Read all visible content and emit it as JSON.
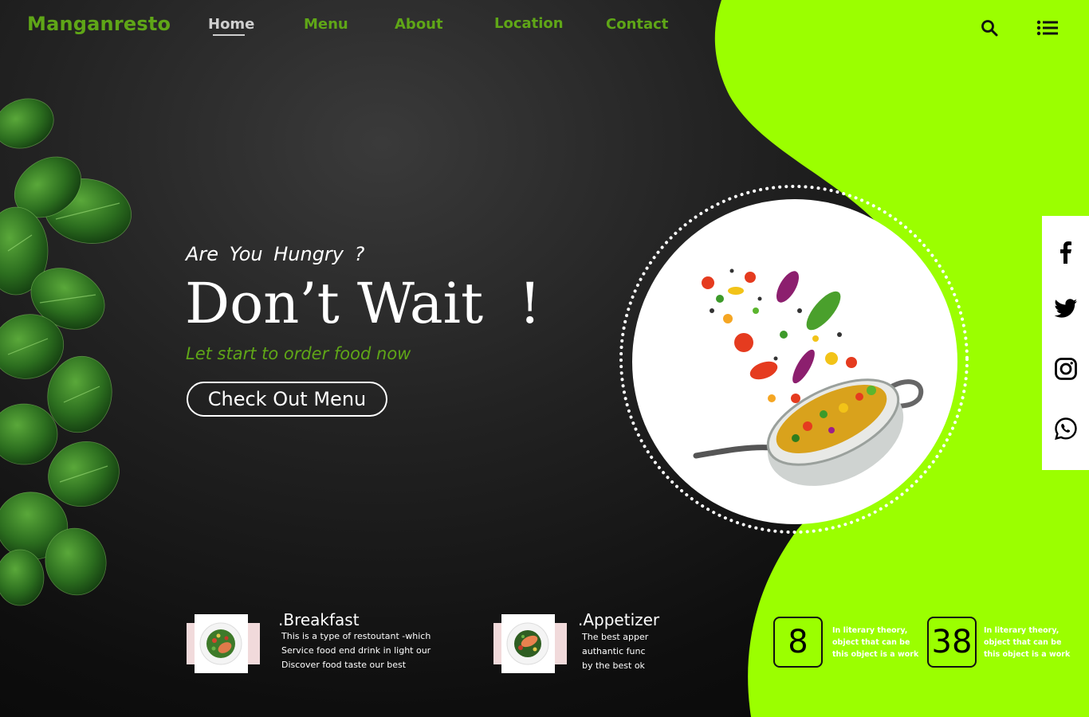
{
  "brand": {
    "name": "Manganresto",
    "accent": "#5fa617",
    "lime": "#9bff00"
  },
  "nav": {
    "items": [
      {
        "label": "Home",
        "active": true
      },
      {
        "label": "Menu"
      },
      {
        "label": "About"
      },
      {
        "label": "Location"
      },
      {
        "label": "Contact"
      }
    ],
    "search_icon": "search-icon",
    "menu_icon": "list-menu-icon"
  },
  "hero": {
    "kicker": "Are You Hungry ?",
    "title": "Don’t Wait  !",
    "subtitle": "Let start to order food now",
    "cta_label": "Check Out Menu"
  },
  "social": [
    "facebook-icon",
    "twitter-icon",
    "instagram-icon",
    "whatsapp-icon"
  ],
  "food_cards": [
    {
      "title": ".Breakfast",
      "lines": [
        "This is a type of restoutant -which",
        "Service food end drink in light our",
        "Discover food taste our best"
      ]
    },
    {
      "title": ".Appetizer",
      "lines": [
        "The best apper",
        "authantic func",
        "by the best ok"
      ]
    }
  ],
  "stats": [
    {
      "value": "8",
      "lines": [
        "In literary theory,",
        "object that can be",
        "this object is a work"
      ]
    },
    {
      "value": "38",
      "lines": [
        "In literary theory,",
        "object that can be",
        "this object is a work"
      ]
    }
  ]
}
